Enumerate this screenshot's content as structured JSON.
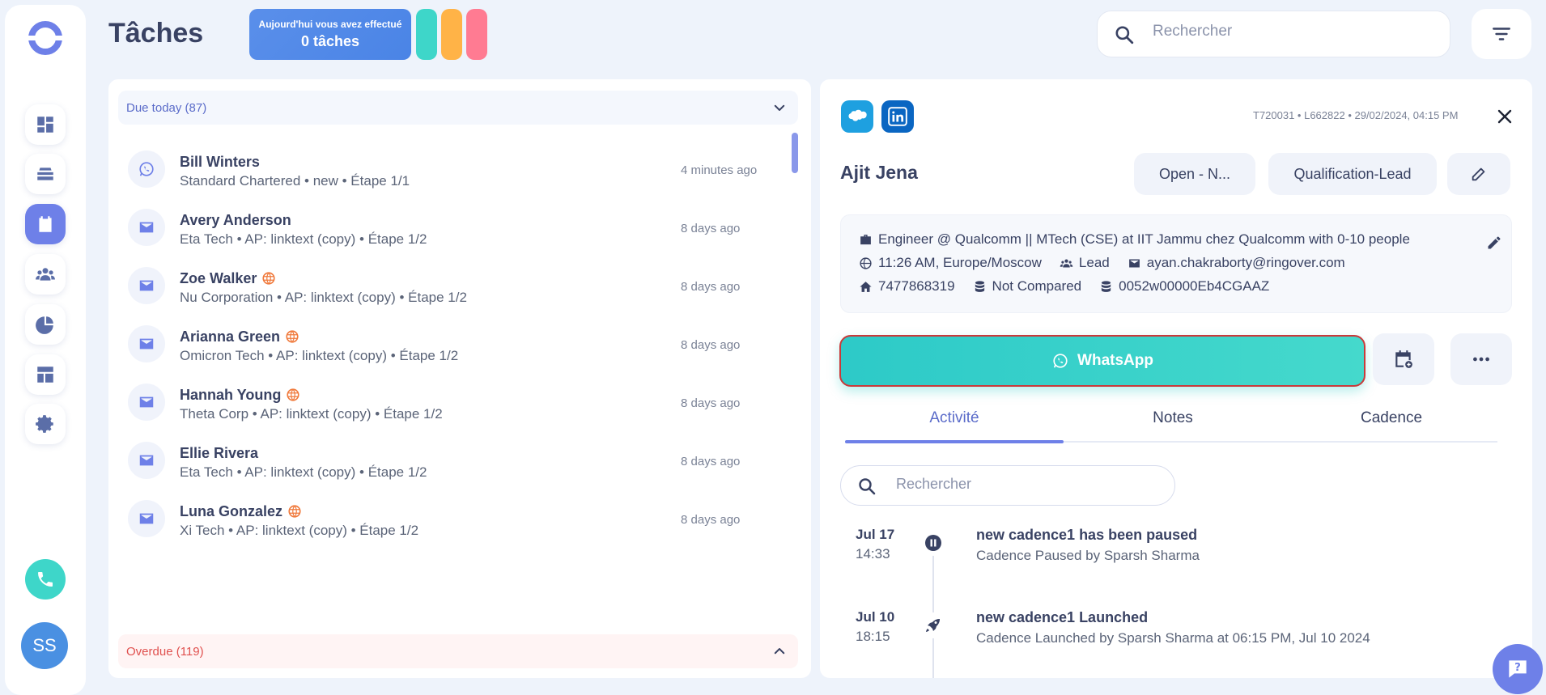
{
  "header": {
    "title": "Tâches",
    "today_label": "Aujourd'hui vous avez effectué",
    "today_count": "0 tâches",
    "search_placeholder": "Rechercher"
  },
  "colors": {
    "accent": "#6e80e8",
    "teal": "#3ed6c9",
    "orange": "#ffb347",
    "pink": "#ff7b92",
    "red": "#e0504e"
  },
  "sidebar": {
    "items": [
      "dashboard-icon",
      "cadences-icon",
      "tasks-icon",
      "people-icon",
      "stats-icon",
      "templates-icon",
      "settings-icon"
    ],
    "active": "tasks-icon",
    "avatar_initials": "SS"
  },
  "tasks": {
    "due_label": "Due today (87)",
    "overdue_label": "Overdue (119)",
    "items": [
      {
        "name": "Bill Winters",
        "sub": "Standard Chartered • new • Étape 1/1",
        "time": "4 minutes ago",
        "type": "whatsapp",
        "warn": false
      },
      {
        "name": "Avery Anderson",
        "sub": "Eta Tech • AP: linktext (copy) • Étape 1/2",
        "time": "8 days ago",
        "type": "mail",
        "warn": false
      },
      {
        "name": "Zoe Walker",
        "sub": "Nu Corporation • AP: linktext (copy) • Étape 1/2",
        "time": "8 days ago",
        "type": "mail",
        "warn": true
      },
      {
        "name": "Arianna Green",
        "sub": "Omicron Tech • AP: linktext (copy) • Étape 1/2",
        "time": "8 days ago",
        "type": "mail",
        "warn": true
      },
      {
        "name": "Hannah Young",
        "sub": "Theta Corp • AP: linktext (copy) • Étape 1/2",
        "time": "8 days ago",
        "type": "mail",
        "warn": true
      },
      {
        "name": "Ellie Rivera",
        "sub": "Eta Tech • AP: linktext (copy) • Étape 1/2",
        "time": "8 days ago",
        "type": "mail",
        "warn": false
      },
      {
        "name": "Luna Gonzalez",
        "sub": "Xi Tech • AP: linktext (copy) • Étape 1/2",
        "time": "8 days ago",
        "type": "mail",
        "warn": true
      }
    ]
  },
  "detail": {
    "meta": "T720031 • L662822 • 29/02/2024, 04:15 PM",
    "name": "Ajit Jena",
    "status_chip": "Open - N...",
    "stage_chip": "Qualification-Lead",
    "job": "Engineer @ Qualcomm || MTech (CSE) at IIT Jammu chez Qualcomm with 0-10 people",
    "local_time": "11:26 AM, Europe/Moscow",
    "type": "Lead",
    "email": "ayan.chakraborty@ringover.com",
    "phone": "7477868319",
    "compare": "Not Compared",
    "crm_id": "0052w00000Eb4CGAAZ",
    "primary_action": "WhatsApp",
    "tabs": [
      "Activité",
      "Notes",
      "Cadence"
    ],
    "active_tab": "Activité",
    "activity_search_placeholder": "Rechercher",
    "activities": [
      {
        "date": "Jul 17",
        "hour": "14:33",
        "title": "new cadence1 has been paused",
        "desc": "Cadence Paused by Sparsh Sharma",
        "icon": "pause-icon"
      },
      {
        "date": "Jul 10",
        "hour": "18:15",
        "title": "new cadence1 Launched",
        "desc": "Cadence Launched by Sparsh Sharma at 06:15 PM, Jul 10 2024",
        "icon": "rocket-icon"
      }
    ]
  }
}
